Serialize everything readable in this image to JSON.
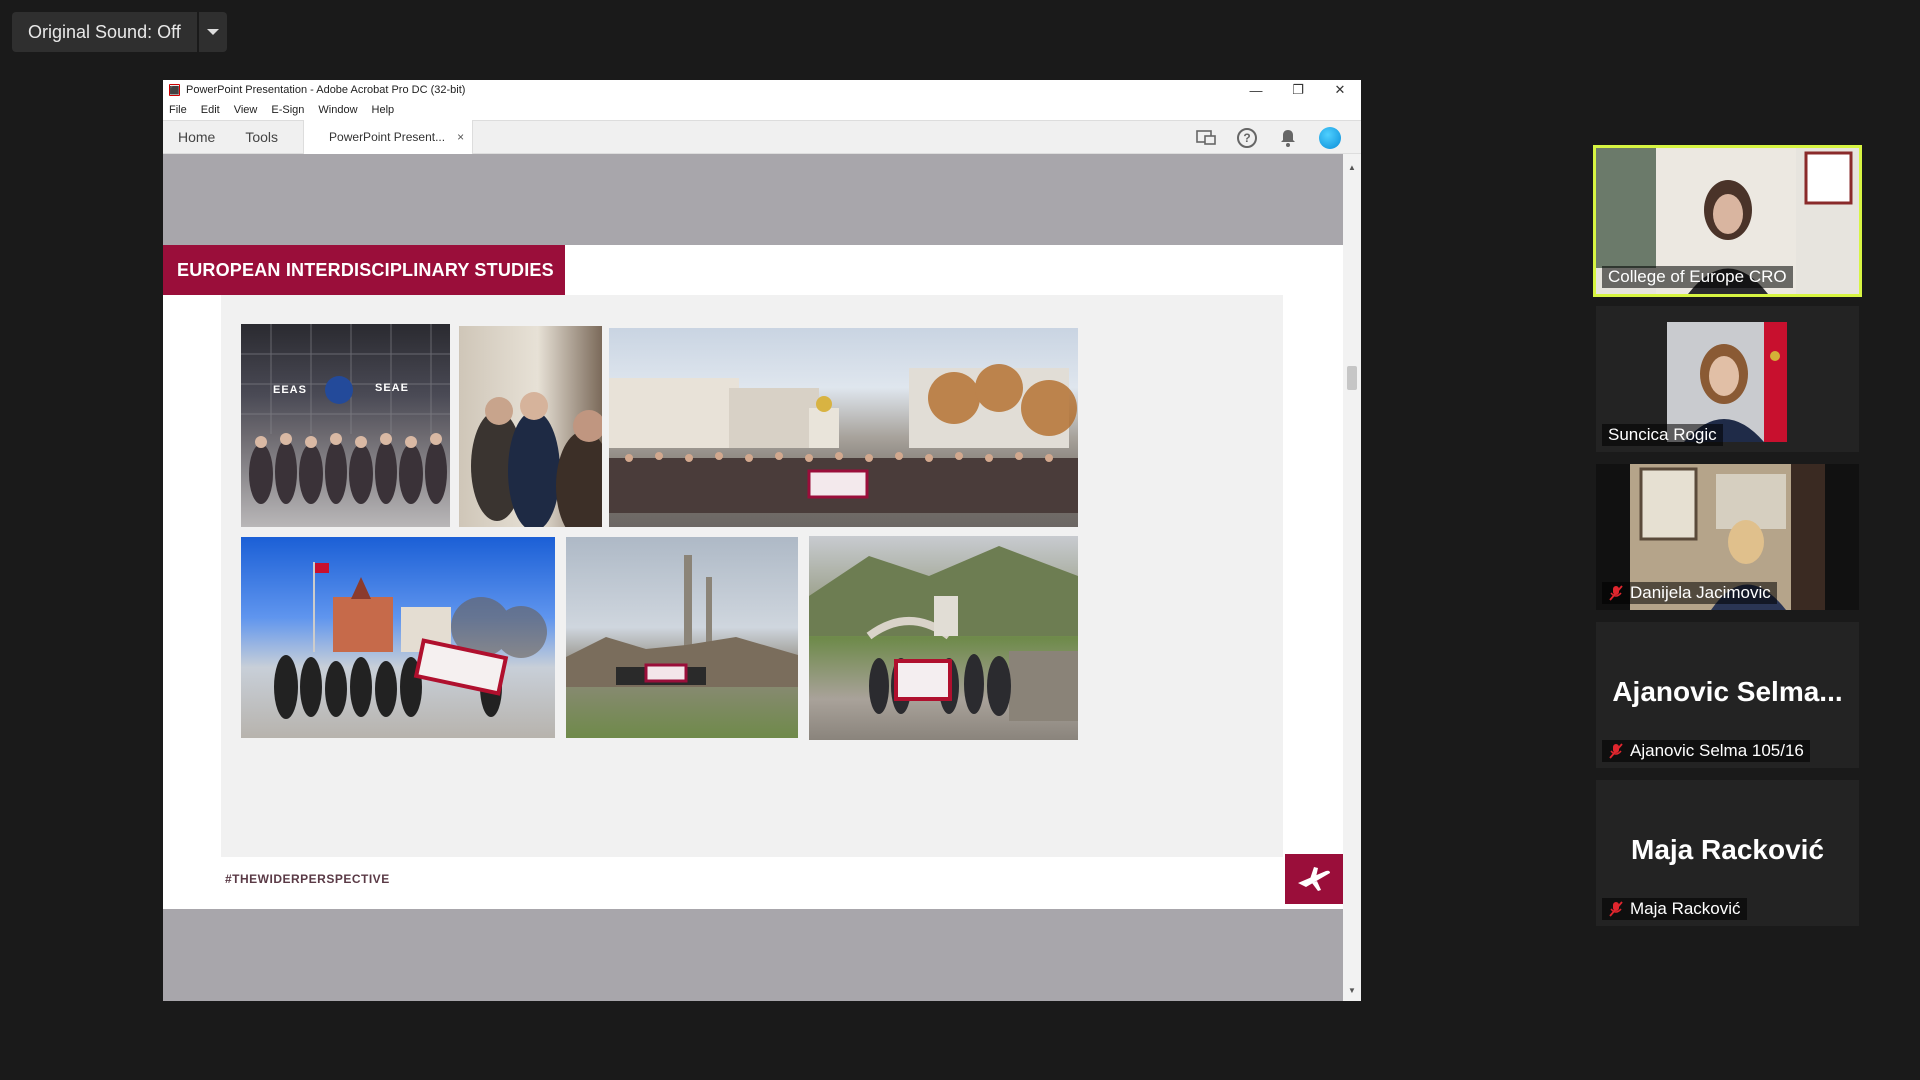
{
  "sound": {
    "label": "Original Sound: Off"
  },
  "acrobat": {
    "title": "PowerPoint Presentation - Adobe Acrobat Pro DC (32-bit)",
    "menu": [
      "File",
      "Edit",
      "View",
      "E-Sign",
      "Window",
      "Help"
    ],
    "nav_tabs": [
      "Home",
      "Tools"
    ],
    "doc_tab": "PowerPoint Present...",
    "close_glyph": "×"
  },
  "slide": {
    "banner": "EUROPEAN INTERDISCIPLINARY STUDIES",
    "hashtag": "#THEWIDERPERSPECTIVE",
    "photo_sign_left": "EEAS",
    "photo_sign_right": "SEAE"
  },
  "participants": [
    {
      "name": "College of Europe CRO",
      "muted": false,
      "active": true
    },
    {
      "name": "Suncica Rogic",
      "muted": false,
      "active": false
    },
    {
      "name": "Danijela Jacimovic",
      "muted": true,
      "active": false
    },
    {
      "name": "Ajanovic Selma 105/16",
      "display": "Ajanovic  Selma...",
      "muted": true,
      "active": false
    },
    {
      "name": "Maja Racković",
      "display": "Maja Racković",
      "muted": true,
      "active": false
    }
  ],
  "colors": {
    "brand": "#9a0e3a",
    "active_speaker": "#d7f542",
    "background": "#1a1a1a"
  }
}
